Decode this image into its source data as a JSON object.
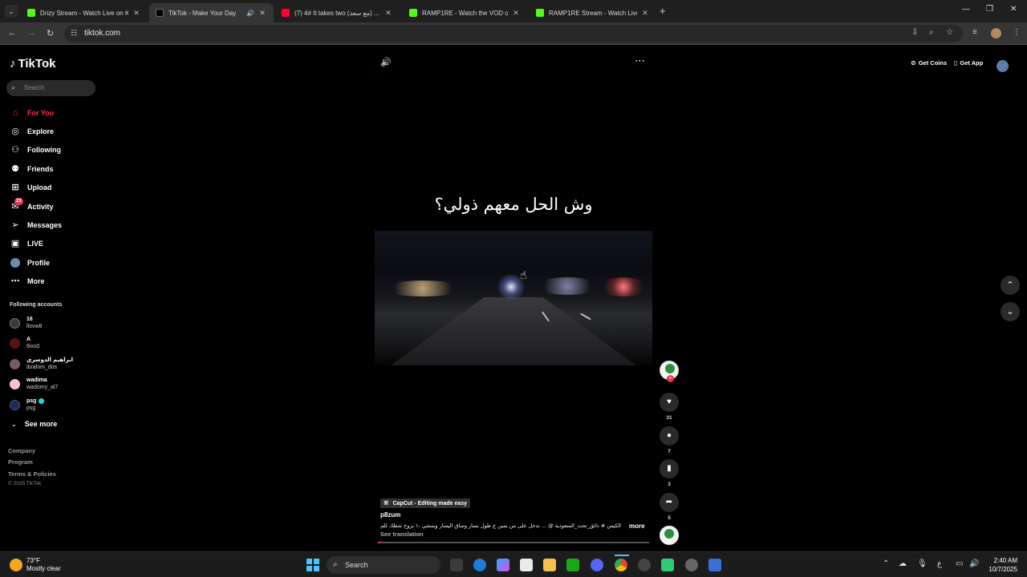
{
  "browser": {
    "tabs": [
      {
        "title": "Drizy Stream - Watch Live on K",
        "favicon_color": "#53fc18",
        "active": false
      },
      {
        "title": "TikTok - Make Your Day",
        "favicon_color": "#111111",
        "active": true
      },
      {
        "title": "(7) 4# It takes two (مع سعد) ...",
        "favicon_color": "#ff0033",
        "active": false
      },
      {
        "title": "RAMP1RE - Watch the VOD on",
        "favicon_color": "#53fc18",
        "active": false
      },
      {
        "title": "RAMP1RE Stream - Watch Live",
        "favicon_color": "#53fc18",
        "active": false
      }
    ],
    "url": "tiktok.com"
  },
  "tiktok": {
    "logo": "TikTok",
    "search_placeholder": "Search",
    "nav": [
      {
        "label": "For You",
        "icon": "home-icon",
        "active": true
      },
      {
        "label": "Explore",
        "icon": "compass-icon"
      },
      {
        "label": "Following",
        "icon": "following-icon"
      },
      {
        "label": "Friends",
        "icon": "friends-icon"
      },
      {
        "label": "Upload",
        "icon": "upload-icon"
      },
      {
        "label": "Activity",
        "icon": "activity-icon",
        "badge": "23"
      },
      {
        "label": "Messages",
        "icon": "messages-icon"
      },
      {
        "label": "LIVE",
        "icon": "live-icon"
      },
      {
        "label": "Profile",
        "icon": "profile-icon"
      },
      {
        "label": "More",
        "icon": "more-icon"
      }
    ],
    "following_title": "Following accounts",
    "following": [
      {
        "name": "16",
        "handle": "llovw8",
        "avatar_color": "#3a3a3a"
      },
      {
        "name": "A",
        "handle": "6ixs0",
        "avatar_color": "#5a1212"
      },
      {
        "name": "ابراهيم الدوسري",
        "handle": "ibrahim_dos",
        "avatar_color": "#7a5a6a"
      },
      {
        "name": "wadima",
        "handle": "wadomy_al7",
        "avatar_color": "#f3c4d4"
      },
      {
        "name": "psg",
        "handle": "psg",
        "avatar_color": "#1a2a6a",
        "verified": true
      }
    ],
    "see_more": "See more",
    "footer_links": [
      "Company",
      "Program",
      "Terms & Policies"
    ],
    "copyright": "© 2025 TikTok",
    "get_coins": "Get Coins",
    "get_app": "Get App",
    "video": {
      "caption": "وش الحل معهم ذولي؟",
      "effect_tag": "CapCut - Editing made easy",
      "author": "p8zum",
      "description": "الكيس # دائق_تحت_السعودية @ ... ندخل على من يمين ع طول يسار وساق اليسار ويمشي ،١ بروح شطك للم بسبب ريكيس ...",
      "more": "more",
      "see_translation": "See translation",
      "progress": 0.01,
      "likes": "31",
      "comments": "7",
      "saves": "3",
      "shares": "5"
    }
  },
  "taskbar": {
    "weather_temp": "73°F",
    "weather_desc": "Mostly clear",
    "search": "Search",
    "time": "2:40 AM",
    "date": "10/7/2025"
  }
}
